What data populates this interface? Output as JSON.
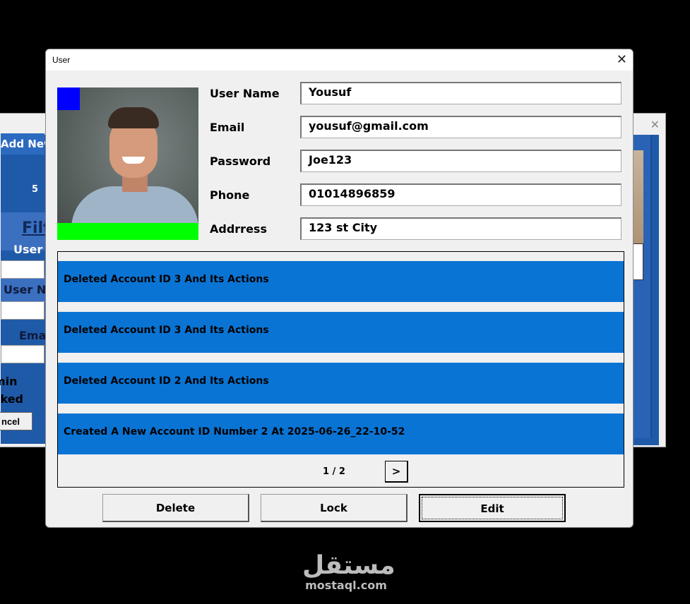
{
  "background_window": {
    "add_new_label": "Add New",
    "count_text": "5",
    "filter_label": "Filt",
    "user_label": "User",
    "user_name_label": "User N",
    "email_label": "Ema",
    "admin_label": "min",
    "locked_label": "cked",
    "cancel_label": "ncel"
  },
  "dialog": {
    "title": "User",
    "close_glyph": "✕",
    "fields": {
      "user_name": {
        "label": "User Name",
        "value": "Yousuf"
      },
      "email": {
        "label": "Email",
        "value": "yousuf@gmail.com"
      },
      "password": {
        "label": "Password",
        "value": "Joe123"
      },
      "phone": {
        "label": "Phone",
        "value": "01014896859"
      },
      "address": {
        "label": "Addrress",
        "value": "123 st City"
      }
    },
    "activity_log": [
      "Deleted Account ID 3 And Its Actions",
      "Deleted Account ID 3 And Its Actions",
      "Deleted Account ID 2 And Its Actions",
      "Created A New Account ID Number 2 At 2025-06-26_22-10-52"
    ],
    "pager": {
      "text": "1 / 2",
      "next_label": ">"
    },
    "buttons": {
      "delete": "Delete",
      "lock": "Lock",
      "edit": "Edit"
    },
    "colors": {
      "log_item": "#0a74d4",
      "marker_blue": "#0000ff",
      "marker_green": "#00ff00"
    }
  },
  "branding": {
    "arabic": "مستقل",
    "latin": "mostaql.com"
  }
}
